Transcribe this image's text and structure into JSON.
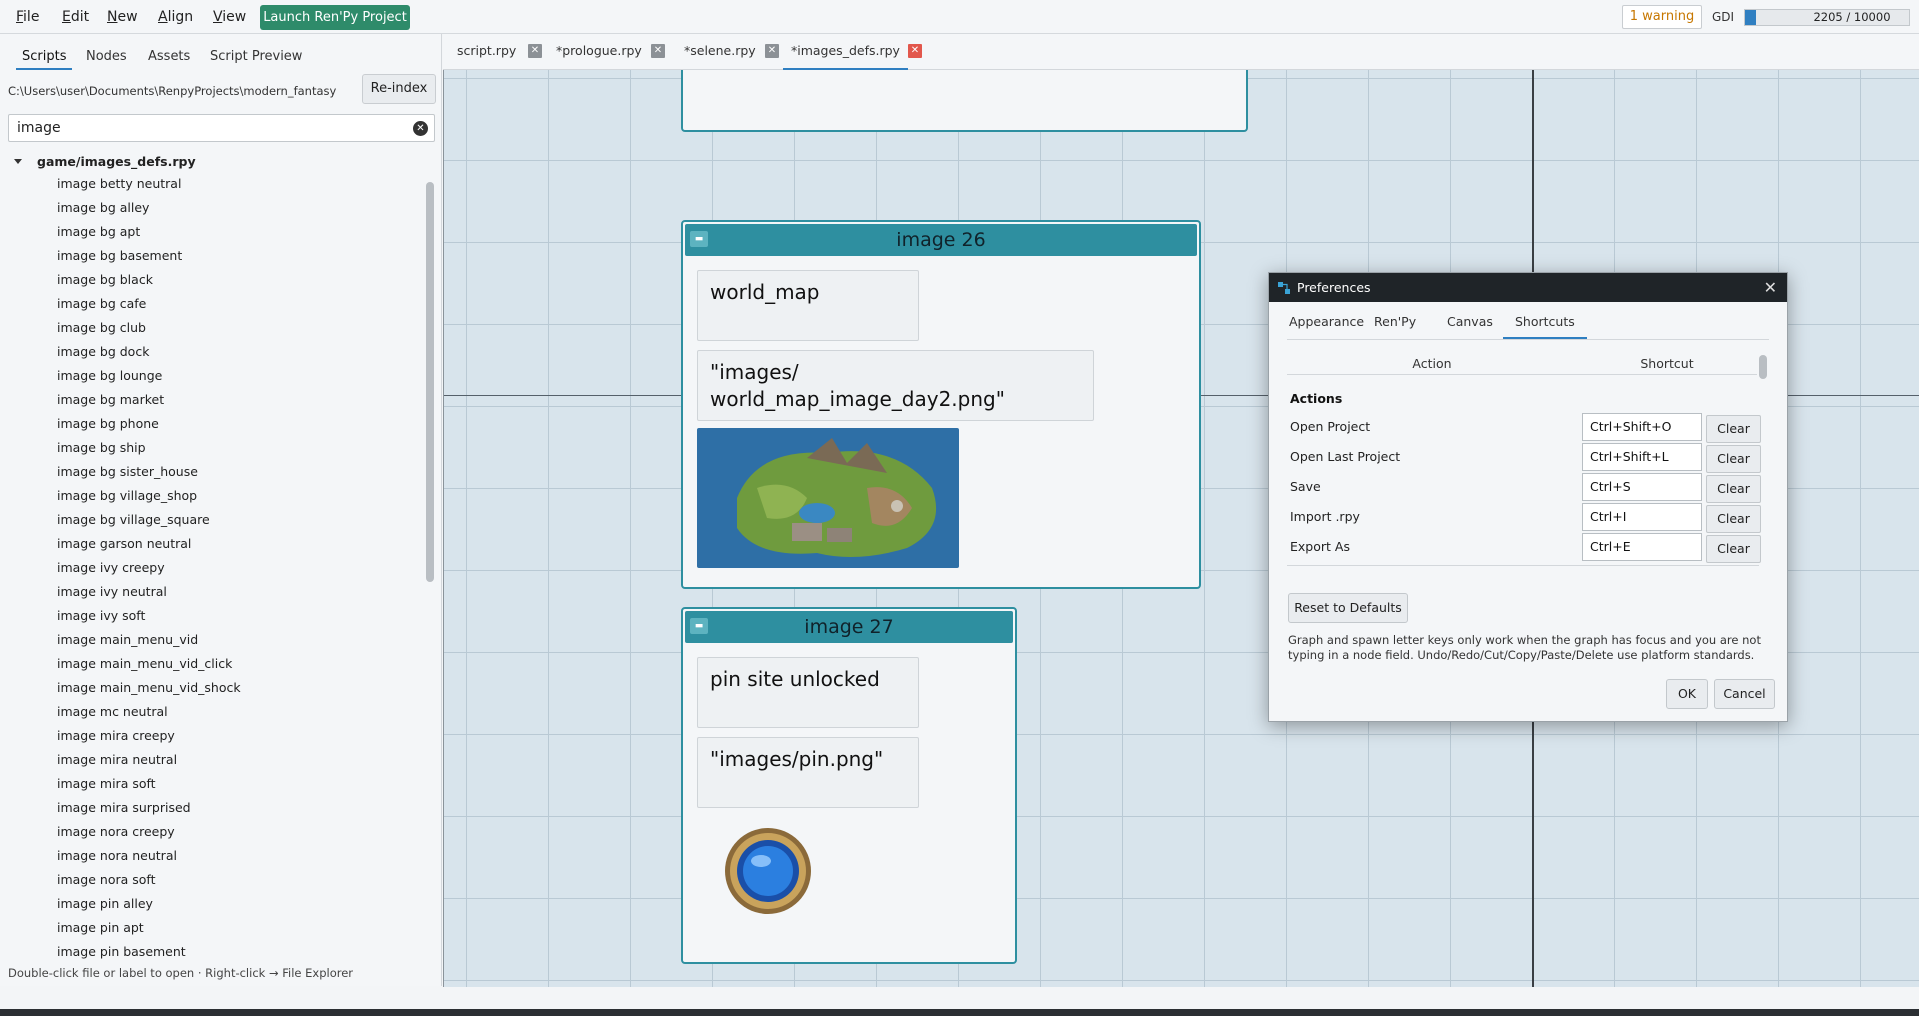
{
  "menubar": {
    "file": "File",
    "edit": "Edit",
    "new": "New",
    "align": "Align",
    "view": "View",
    "launch": "Launch Ren'Py Project",
    "warnings": "1 warning",
    "gdi_label": "GDI",
    "gdi_value": "2205 / 10000",
    "gdi_fraction": 0.2205
  },
  "leftpanel": {
    "tabs": [
      "Scripts",
      "Nodes",
      "Assets",
      "Script Preview"
    ],
    "path": "C:\\Users\\user\\Documents\\RenpyProjects\\modern_fantasy",
    "reindex": "Re-index",
    "search_value": "image",
    "file": "game/images_defs.rpy",
    "items": [
      "image betty neutral",
      "image bg alley",
      "image bg apt",
      "image bg basement",
      "image bg black",
      "image bg cafe",
      "image bg club",
      "image bg dock",
      "image bg lounge",
      "image bg market",
      "image bg phone",
      "image bg ship",
      "image bg sister_house",
      "image bg village_shop",
      "image bg village_square",
      "image garson neutral",
      "image ivy creepy",
      "image ivy neutral",
      "image ivy soft",
      "image main_menu_vid",
      "image main_menu_vid_click",
      "image main_menu_vid_shock",
      "image mc neutral",
      "image mira creepy",
      "image mira neutral",
      "image mira soft",
      "image mira surprised",
      "image nora creepy",
      "image nora neutral",
      "image nora soft",
      "image pin alley",
      "image pin apt",
      "image pin basement"
    ],
    "footer": "Double-click file or label to open · Right-click → File Explorer"
  },
  "tabs": [
    {
      "label": "script.rpy",
      "close": "✕"
    },
    {
      "label": "*prologue.rpy",
      "close": "✕"
    },
    {
      "label": "*selene.rpy",
      "close": "✕"
    },
    {
      "label": "*images_defs.rpy",
      "close": "✕"
    }
  ],
  "canvas": {
    "node26": {
      "title": "image 26",
      "name": "world_map",
      "path": "\"images/\nworld_map_image_day2.png\""
    },
    "node27": {
      "title": "image 27",
      "name": "pin site unlocked",
      "path": "\"images/pin.png\""
    }
  },
  "dialog": {
    "title": "Preferences",
    "close": "✕",
    "tabs": [
      "Appearance",
      "Ren'Py",
      "Canvas",
      "Shortcuts"
    ],
    "col_action": "Action",
    "col_shortcut": "Shortcut",
    "section": "Actions",
    "rows": [
      {
        "action": "Open Project",
        "shortcut": "Ctrl+Shift+O",
        "clear": "Clear"
      },
      {
        "action": "Open Last Project",
        "shortcut": "Ctrl+Shift+L",
        "clear": "Clear"
      },
      {
        "action": "Save",
        "shortcut": "Ctrl+S",
        "clear": "Clear"
      },
      {
        "action": "Import .rpy",
        "shortcut": "Ctrl+I",
        "clear": "Clear"
      },
      {
        "action": "Export As",
        "shortcut": "Ctrl+E",
        "clear": "Clear"
      }
    ],
    "reset": "Reset to Defaults",
    "note": "Graph and spawn letter keys only work when the graph has focus and you are not typing in a node field. Undo/Redo/Cut/Copy/Paste/Delete use platform standards.",
    "ok": "OK",
    "cancel": "Cancel"
  },
  "colors": {
    "accent": "#2f7fc1",
    "launch_green": "#2e8b6a",
    "node_teal": "#2e8fa0",
    "warning_orange": "#c77700",
    "close_red": "#e2574c"
  }
}
